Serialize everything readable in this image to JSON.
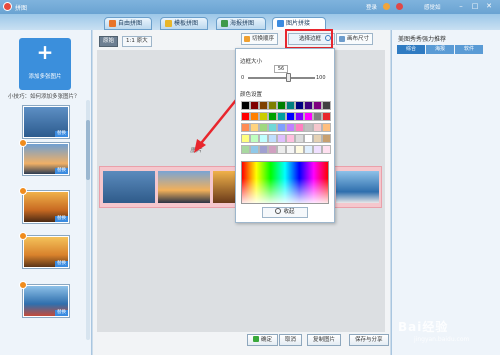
{
  "titlebar": {
    "title": "拼图",
    "login": "登录",
    "feedback": "感觉如",
    "min": "–",
    "max": "□",
    "close": "✕"
  },
  "tabs": [
    {
      "label": "自由拼图",
      "active": false
    },
    {
      "label": "模板拼图",
      "active": false
    },
    {
      "label": "海报拼图",
      "active": false
    },
    {
      "label": "图片拼接",
      "active": true
    }
  ],
  "left": {
    "add_label": "添加多张图片",
    "help": "小技巧：如何添加多张图片？",
    "replace_label": "替换"
  },
  "toolbar": {
    "original_label": "原始",
    "ratio_label": "1:1 原大",
    "shuffle_label": "切换顺序",
    "border_label": "选择边框",
    "size_label": "画布尺寸"
  },
  "popup": {
    "border_size_label": "边框大小",
    "border_value": "56",
    "min": "0",
    "max": "100",
    "color_label": "颜色设置",
    "collapse_label": "收起",
    "swatches": [
      "#000000",
      "#7f0000",
      "#7f3f00",
      "#7f7f00",
      "#007f00",
      "#007f7f",
      "#00007f",
      "#3f007f",
      "#7f007f",
      "#404040",
      "#ff0000",
      "#ff7f00",
      "#cccc00",
      "#00a000",
      "#00a0a0",
      "#0000ff",
      "#7f00ff",
      "#ff00ff",
      "#808080",
      "#e8262d",
      "#ff8c55",
      "#ffd37f",
      "#9fd87f",
      "#6fd8d8",
      "#7f9fff",
      "#c07fff",
      "#ff7fc0",
      "#bfbfbf",
      "#f5c7cd",
      "#ffbf7f",
      "#ffff7f",
      "#bfffbf",
      "#bfffff",
      "#bfdfff",
      "#dfbfff",
      "#ffbfdf",
      "#dcdcdc",
      "#ffffff",
      "#e6d2b5",
      "#c8a070",
      "#a8d8a0",
      "#90c8e8",
      "#a0a0d0",
      "#d0a0c0",
      "#ececec",
      "#f5f5f5",
      "#fffbe0",
      "#e0f0ff",
      "#f0e0ff",
      "#ffe0f0"
    ]
  },
  "watermark_text": "图片",
  "bottom": {
    "confirm": "确定",
    "cancel": "取消",
    "copy": "复制图片",
    "save_share": "保存与分享"
  },
  "right": {
    "title": "美图秀秀强力推荐",
    "tabs": [
      "综合",
      "海报",
      "软件"
    ]
  },
  "baidu": {
    "logo": "Bai经验",
    "url": "jingyan.baidu.com"
  }
}
